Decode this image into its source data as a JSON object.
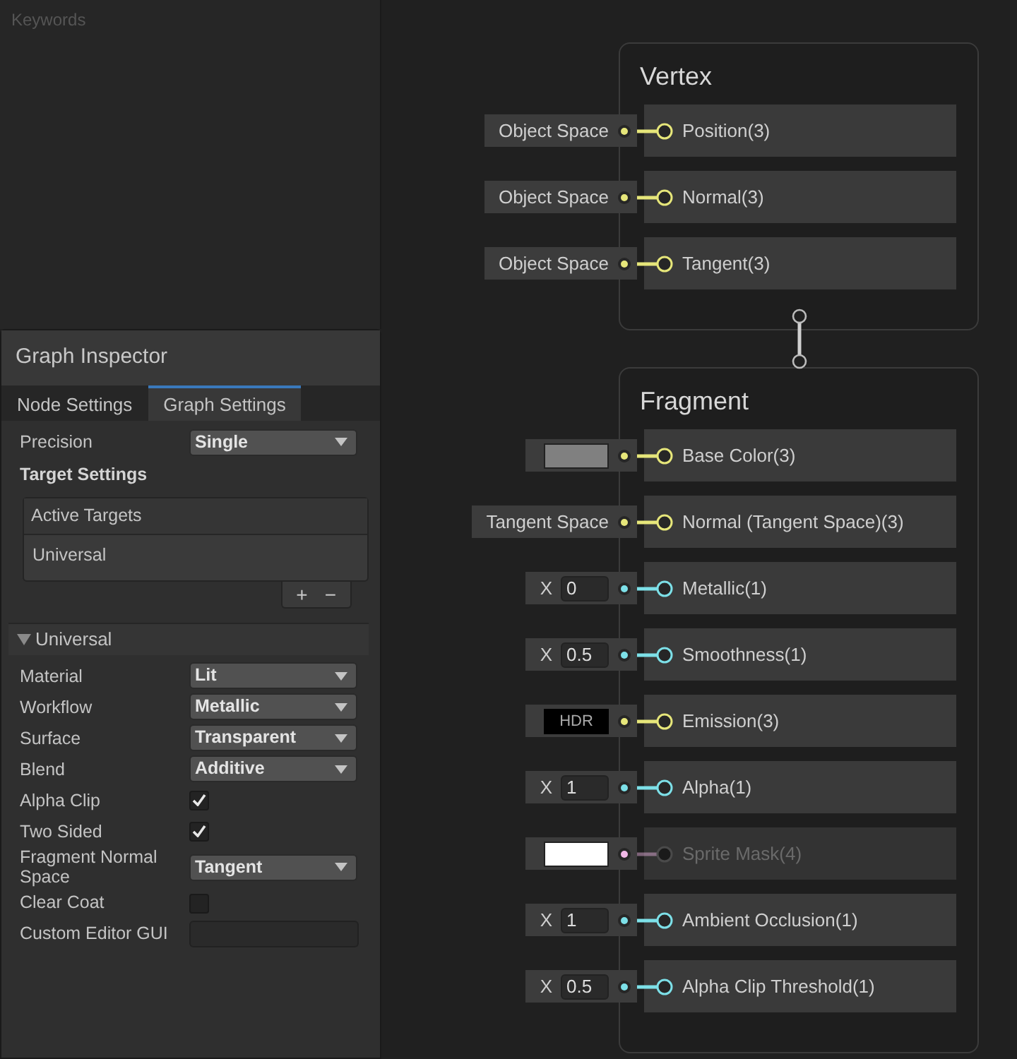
{
  "keywords_panel": {
    "title": "Keywords"
  },
  "inspector": {
    "title": "Graph Inspector",
    "tabs": [
      {
        "label": "Node Settings",
        "selected": false
      },
      {
        "label": "Graph Settings",
        "selected": true
      }
    ],
    "precision": {
      "label": "Precision",
      "value": "Single"
    },
    "target_settings": {
      "heading": "Target Settings",
      "list_header": "Active Targets",
      "items": [
        "Universal"
      ],
      "add_button": "+",
      "remove_button": "−"
    },
    "section": {
      "title": "Universal",
      "expanded": true,
      "settings": [
        {
          "kind": "dropdown",
          "label": "Material",
          "value": "Lit"
        },
        {
          "kind": "dropdown",
          "label": "Workflow",
          "value": "Metallic"
        },
        {
          "kind": "dropdown",
          "label": "Surface",
          "value": "Transparent"
        },
        {
          "kind": "dropdown",
          "label": "Blend",
          "value": "Additive"
        },
        {
          "kind": "checkbox",
          "label": "Alpha Clip",
          "checked": true
        },
        {
          "kind": "checkbox",
          "label": "Two Sided",
          "checked": true
        },
        {
          "kind": "dropdown",
          "label": "Fragment Normal Space",
          "value": "Tangent"
        },
        {
          "kind": "checkbox",
          "label": "Clear Coat",
          "checked": false
        },
        {
          "kind": "field",
          "label": "Custom Editor GUI"
        }
      ]
    }
  },
  "nodes": [
    {
      "title": "Vertex",
      "slots": [
        {
          "label": "Position(3)",
          "color": "#e6e67a",
          "disabled": false,
          "input": {
            "kind": "text",
            "text": "Object Space"
          }
        },
        {
          "label": "Normal(3)",
          "color": "#e6e67a",
          "disabled": false,
          "input": {
            "kind": "text",
            "text": "Object Space"
          }
        },
        {
          "label": "Tangent(3)",
          "color": "#e6e67a",
          "disabled": false,
          "input": {
            "kind": "text",
            "text": "Object Space"
          }
        }
      ]
    },
    {
      "title": "Fragment",
      "slots": [
        {
          "label": "Base Color(3)",
          "color": "#e6e67a",
          "disabled": false,
          "input": {
            "kind": "swatch",
            "color": "#808080"
          }
        },
        {
          "label": "Normal (Tangent Space)(3)",
          "color": "#e6e67a",
          "disabled": false,
          "input": {
            "kind": "text",
            "text": "Tangent Space"
          }
        },
        {
          "label": "Metallic(1)",
          "color": "#7de0e8",
          "disabled": false,
          "input": {
            "kind": "number",
            "axis": "X",
            "value": "0"
          }
        },
        {
          "label": "Smoothness(1)",
          "color": "#7de0e8",
          "disabled": false,
          "input": {
            "kind": "number",
            "axis": "X",
            "value": "0.5"
          }
        },
        {
          "label": "Emission(3)",
          "color": "#e6e67a",
          "disabled": false,
          "input": {
            "kind": "hdr",
            "text": "HDR"
          }
        },
        {
          "label": "Alpha(1)",
          "color": "#7de0e8",
          "disabled": false,
          "input": {
            "kind": "number",
            "axis": "X",
            "value": "1"
          }
        },
        {
          "label": "Sprite Mask(4)",
          "color": "#f0b8e6",
          "disabled": true,
          "input": {
            "kind": "swatch",
            "color": "#ffffff"
          }
        },
        {
          "label": "Ambient Occlusion(1)",
          "color": "#7de0e8",
          "disabled": false,
          "input": {
            "kind": "number",
            "axis": "X",
            "value": "1"
          }
        },
        {
          "label": "Alpha Clip Threshold(1)",
          "color": "#7de0e8",
          "disabled": false,
          "input": {
            "kind": "number",
            "axis": "X",
            "value": "0.5"
          }
        }
      ]
    }
  ]
}
